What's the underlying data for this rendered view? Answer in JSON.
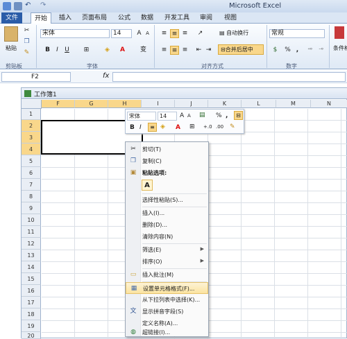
{
  "window": {
    "title": "Microsoft Excel"
  },
  "ribbon": {
    "tabs": [
      "文件",
      "开始",
      "插入",
      "页面布局",
      "公式",
      "数据",
      "开发工具",
      "审阅",
      "视图"
    ],
    "clipboard": {
      "paste_label": "粘贴",
      "group_label": "剪贴板"
    },
    "font": {
      "name": "宋体",
      "size": "14",
      "bold": "B",
      "italic": "I",
      "underline": "U",
      "font_color_letter": "A",
      "phonetic_glyph": "变",
      "group_label": "字体"
    },
    "alignment": {
      "wrap_text": "自动换行",
      "merge_center": "合并后居中",
      "group_label": "对齐方式"
    },
    "number": {
      "format": "常规",
      "percent": "%",
      "comma": ",",
      "group_label": "数字"
    },
    "styles": {
      "conditional_label": "条件格"
    }
  },
  "formula_bar": {
    "name_box": "F2",
    "fx": "fx",
    "value": ""
  },
  "workbook": {
    "title": "工作簿1",
    "columns": [
      "F",
      "G",
      "H",
      "I",
      "J",
      "K",
      "L",
      "M",
      "N"
    ],
    "rows": [
      "1",
      "2",
      "3",
      "4",
      "5",
      "6",
      "7",
      "8",
      "9",
      "10",
      "11",
      "12",
      "13",
      "14",
      "15",
      "16",
      "17",
      "18",
      "19",
      "20"
    ]
  },
  "mini_toolbar": {
    "font_name": "宋体",
    "font_size": "14",
    "grow": "A",
    "shrink": "A",
    "percent": "%",
    "comma": ",",
    "bold": "B",
    "italic": "I",
    "font_color": "A",
    "dec_inc": "+.0",
    "dec_dec": ".00"
  },
  "context_menu": {
    "cut": "剪切(T)",
    "copy": "复制(C)",
    "paste_options": "粘贴选项:",
    "paste_option_letter": "A",
    "paste_special": "选择性粘贴(S)...",
    "insert": "插入(I)...",
    "delete": "删除(D)...",
    "clear": "清除内容(N)",
    "filter": "筛选(E)",
    "sort": "排序(O)",
    "insert_comment": "插入批注(M)",
    "format_cells": "设置单元格格式(F)...",
    "pick_from_list": "从下拉列表中选择(K)...",
    "show_phonetic": "显示拼音字段(S)",
    "define_name": "定义名称(A)...",
    "hyperlink": "超链接(I)..."
  }
}
